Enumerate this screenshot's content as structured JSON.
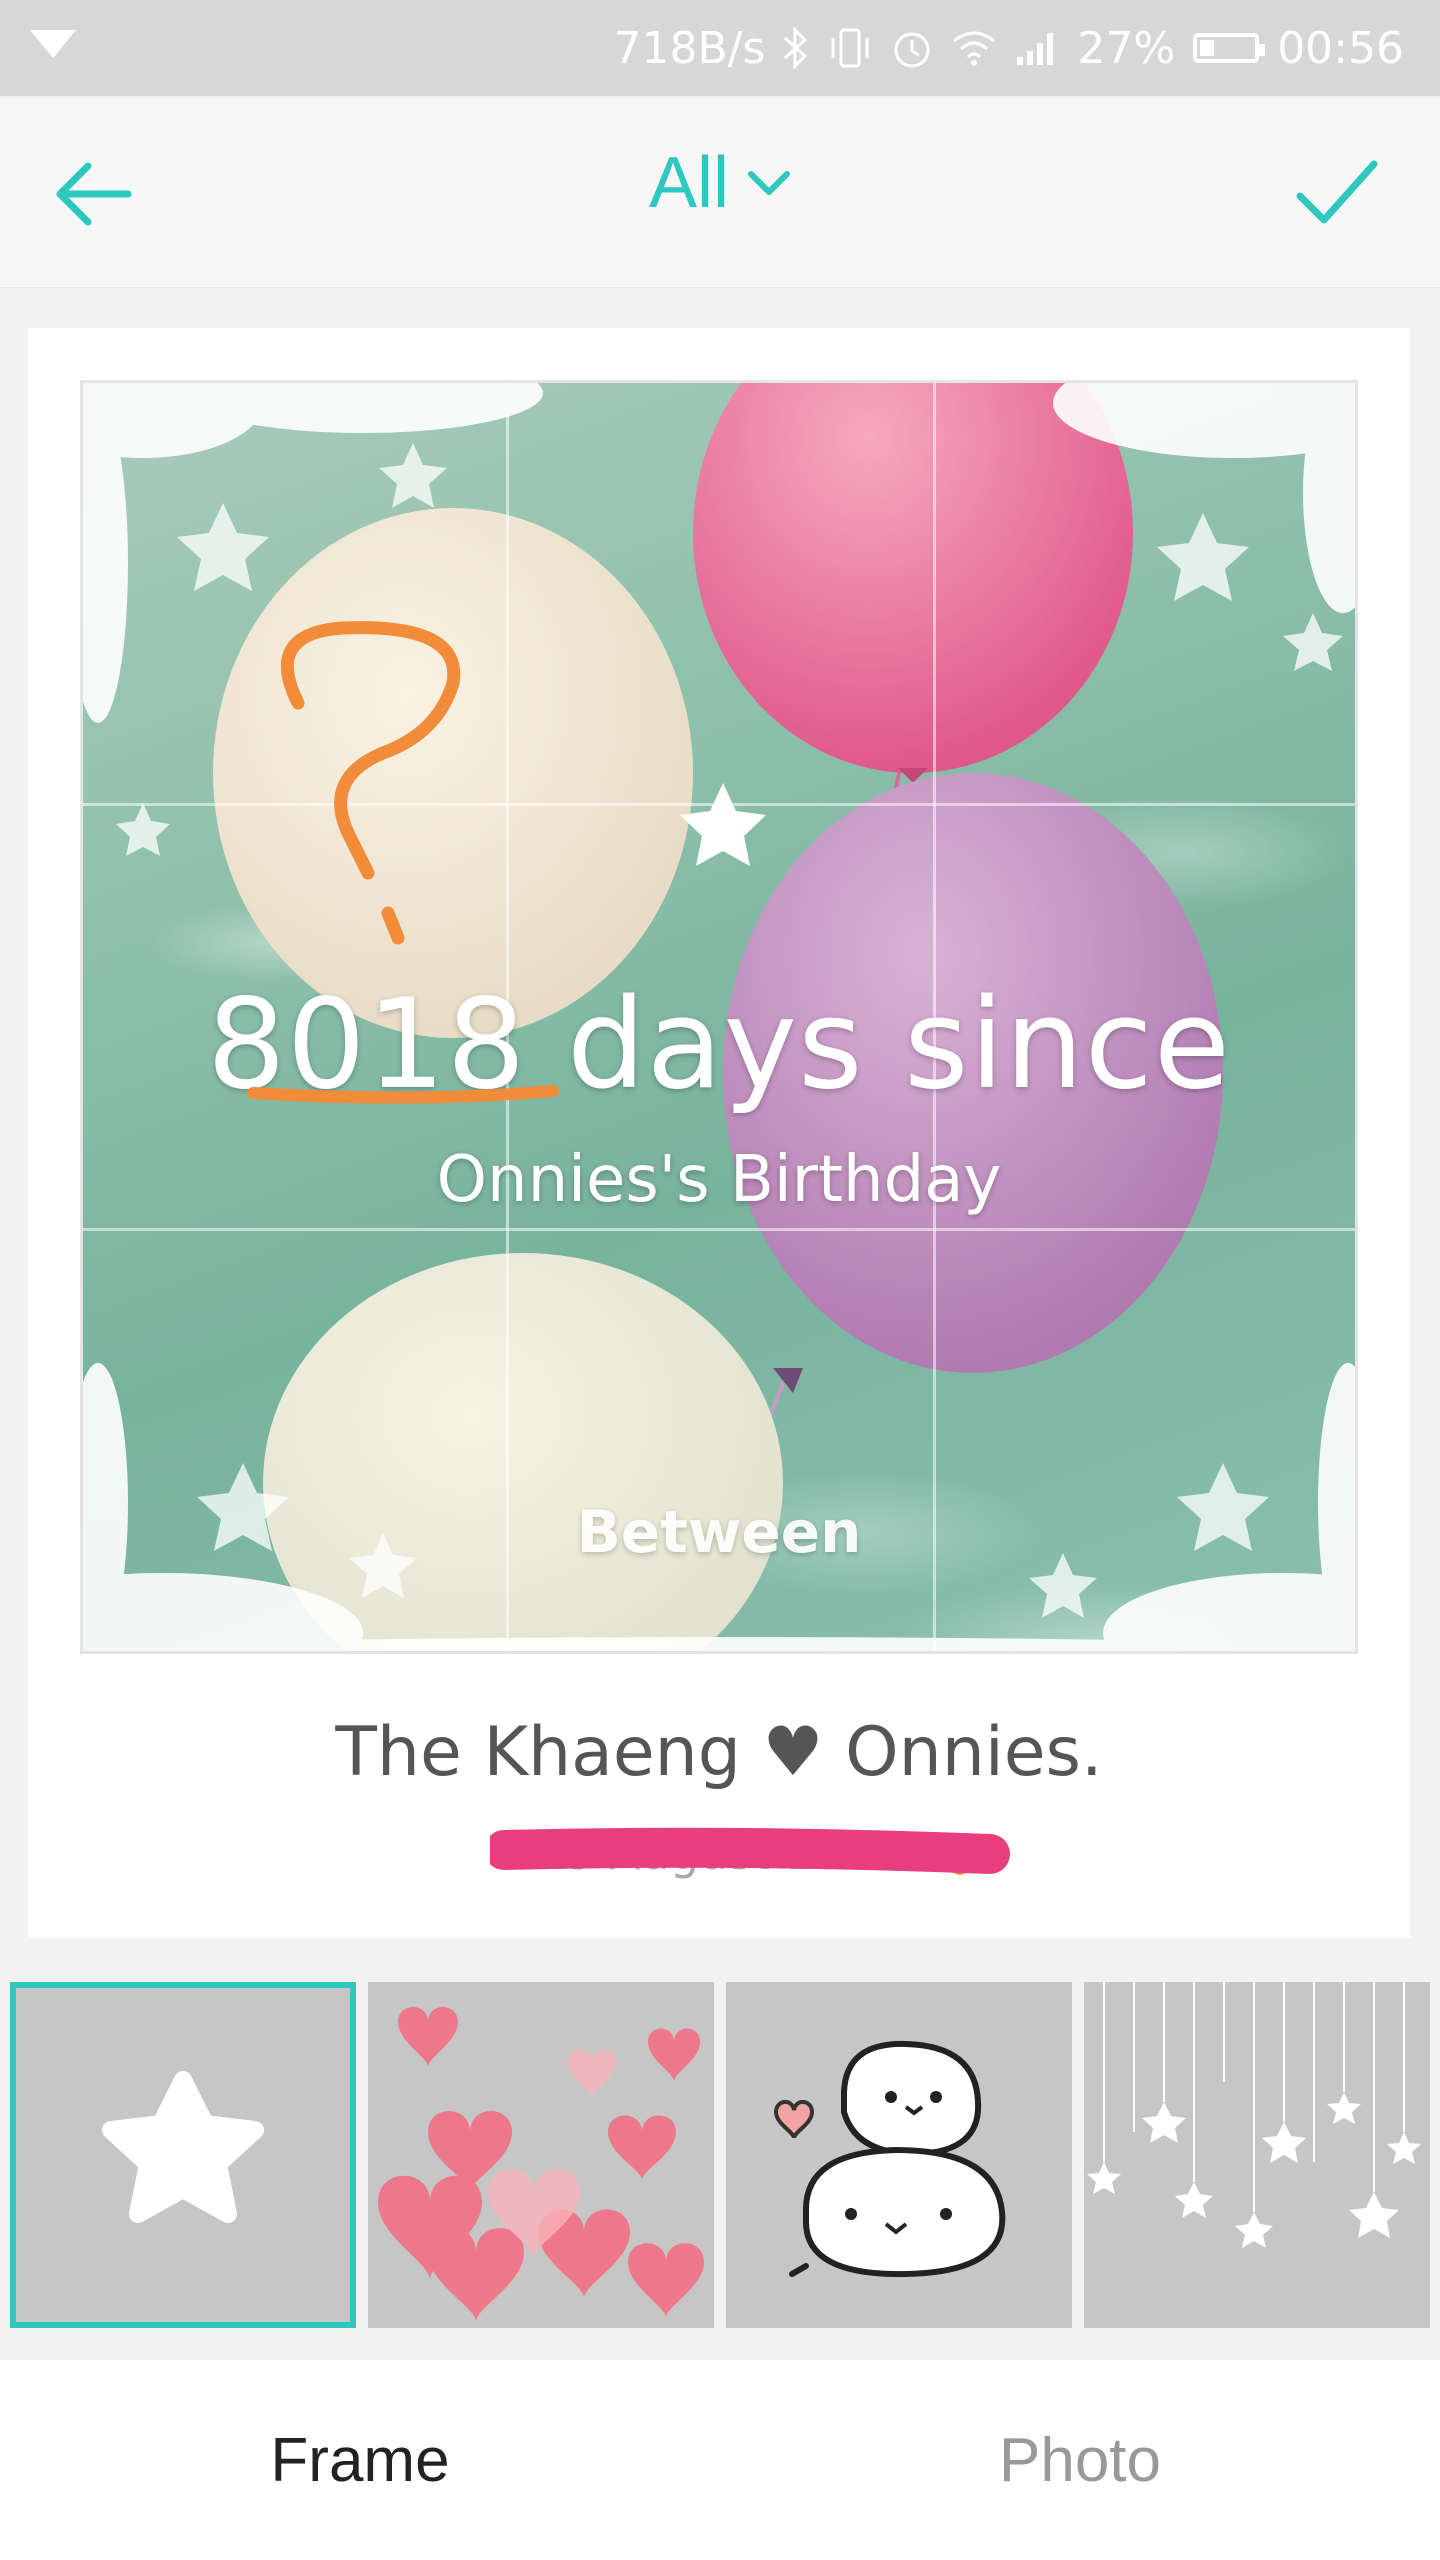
{
  "status_bar": {
    "net_speed": "718B/s",
    "battery_percent": "27%",
    "battery_level": 0.27,
    "time": "00:56",
    "icons": [
      "dropdown-icon",
      "bluetooth-icon",
      "vibrate-icon",
      "alarm-icon",
      "wifi-icon",
      "signal-icon",
      "battery-icon"
    ]
  },
  "toolbar": {
    "title": "All",
    "back_icon": "arrow-left-icon",
    "dropdown_icon": "chevron-down-icon",
    "confirm_icon": "checkmark-icon"
  },
  "preview": {
    "title": "8018 days since",
    "subtitle": "Onnies's Birthday",
    "brand": "Between"
  },
  "card": {
    "caption": "The Khaeng ♥ Onnies.",
    "date": "13 August 1995"
  },
  "thumbnails": [
    {
      "name": "white star frame",
      "selected": true
    },
    {
      "name": "pink hearts frame",
      "selected": false
    },
    {
      "name": "seal stickers frame",
      "selected": false
    },
    {
      "name": "hanging stars frame",
      "selected": false
    }
  ],
  "tabs": {
    "frame": "Frame",
    "photo": "Photo"
  },
  "colors": {
    "accent": "#2ec8c0",
    "status_bar": "#d7d7d7",
    "annotation_orange": "#f08c3a",
    "annotation_pink": "#e83e7e"
  }
}
